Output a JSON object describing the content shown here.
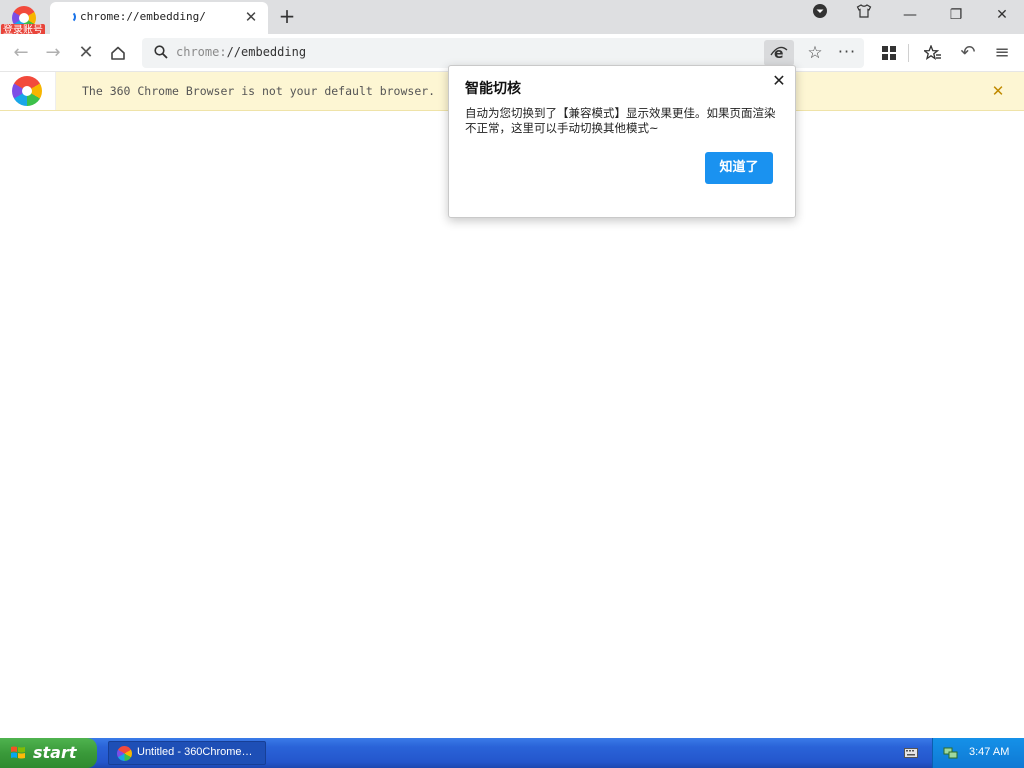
{
  "browser": {
    "login_badge": "登录账号",
    "tab": {
      "title": "chrome://embedding/",
      "close_glyph": "✕"
    },
    "new_tab_glyph": "+",
    "window_controls": {
      "menu": "▾",
      "skin": "T",
      "minimize": "—",
      "restore": "❐",
      "close": "✕"
    }
  },
  "toolbar": {
    "back": "←",
    "forward": "→",
    "stop": "✕",
    "home": "⌂",
    "address": {
      "scheme": "chrome:",
      "rest": "//embedding"
    },
    "mode_glyph": "e",
    "star_glyph": "☆",
    "more_glyph": "···",
    "apps_glyph": "▦",
    "favorites_glyph": "★",
    "undo_glyph": "↶",
    "menu_glyph": "≡"
  },
  "infobar": {
    "message": "The 360 Chrome Browser is not your default browser.",
    "close_glyph": "✕"
  },
  "popup": {
    "title": "智能切核",
    "body": "自动为您切换到了【兼容模式】显示效果更佳。如果页面渲染不正常，这里可以手动切换其他模式~",
    "button": "知道了",
    "close_glyph": "✕"
  },
  "taskbar": {
    "start": "start",
    "task_label": "Untitled - 360Chrome…",
    "clock": "3:47 AM"
  },
  "colors": {
    "accent": "#1a92f0",
    "infobar_bg": "#fdf6d3",
    "taskbar": "#2456cc",
    "start": "#3a9a3a"
  },
  "icons": [
    "360-logo-icon",
    "loading-spinner-icon",
    "search-icon",
    "compatibility-mode-icon",
    "star-icon",
    "apps-icon",
    "favorites-icon",
    "undo-icon",
    "menu-icon",
    "windows-flag-icon",
    "keyboard-icon",
    "network-icon"
  ]
}
